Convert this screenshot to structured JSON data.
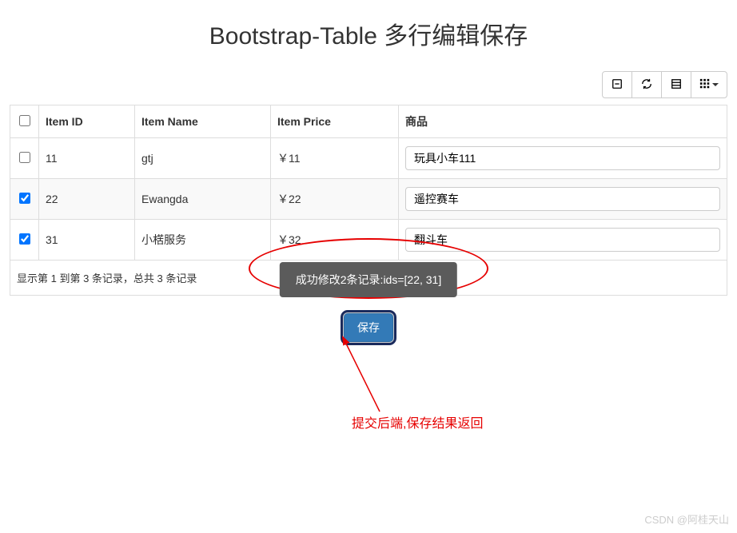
{
  "title": "Bootstrap-Table 多行编辑保存",
  "toolbar": {
    "toggle_title": "Toggle",
    "refresh_title": "Refresh",
    "fullscreen_title": "Fullscreen",
    "columns_title": "Columns"
  },
  "headers": {
    "id": "Item ID",
    "name": "Item Name",
    "price": "Item Price",
    "product": "商品"
  },
  "rows": [
    {
      "checked": false,
      "id": "11",
      "name": "gtj",
      "price": "￥11",
      "product": "玩具小车111"
    },
    {
      "checked": true,
      "id": "22",
      "name": "Ewangda",
      "price": "￥22",
      "product": "遥控赛车"
    },
    {
      "checked": true,
      "id": "31",
      "name": "小楛服务",
      "price": "￥32",
      "product": "翻斗车"
    }
  ],
  "pagination_info": "显示第 1 到第 3 条记录，总共 3 条记录",
  "save_label": "保存",
  "toast_message": "成功修改2条记录:ids=[22, 31]",
  "annotation": "提交后端,保存结果返回",
  "watermark": "CSDN @阿桂天山"
}
